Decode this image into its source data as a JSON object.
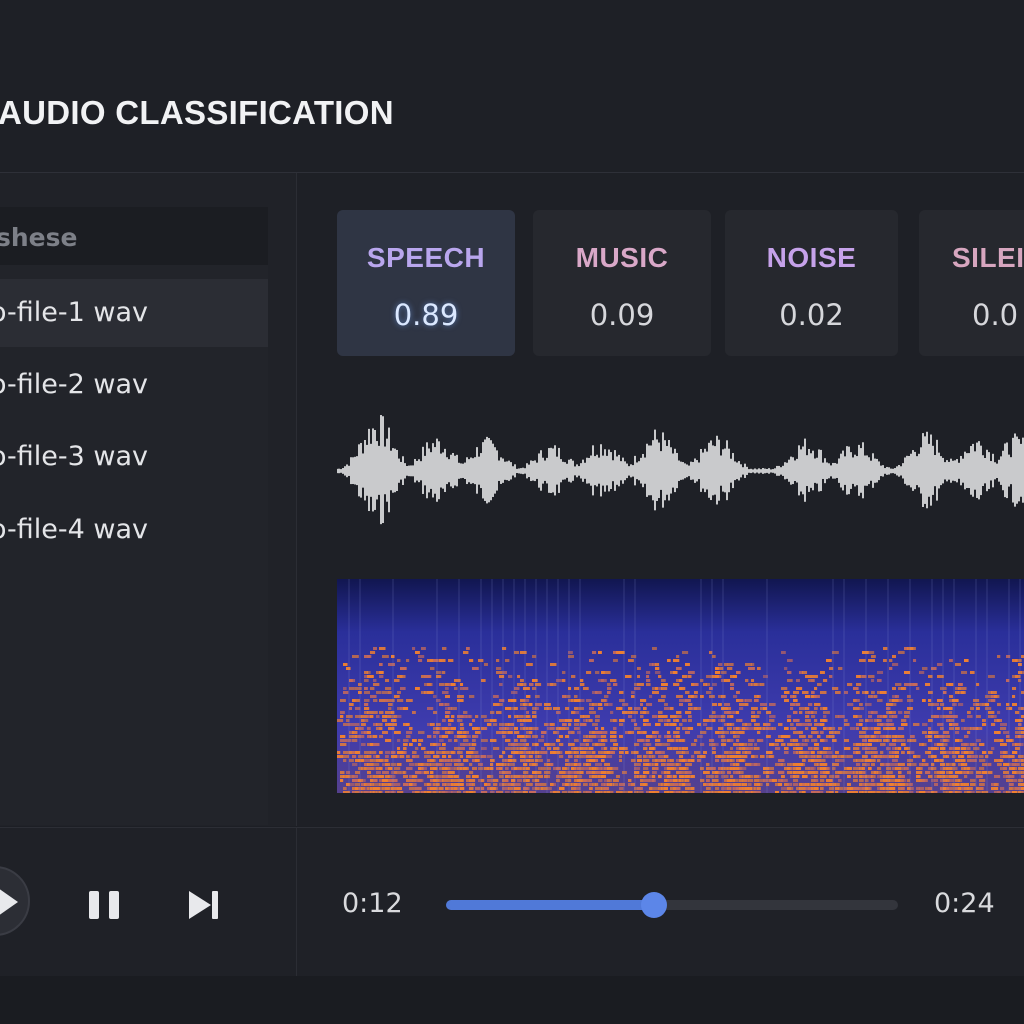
{
  "app": {
    "title": "AUDIO CLASSIFICATION"
  },
  "sidebar": {
    "header": "shese",
    "items": [
      {
        "label": "o-file-1 wav",
        "selected": true
      },
      {
        "label": "o-file-2 wav",
        "selected": false
      },
      {
        "label": "o-file-3 wav",
        "selected": false
      },
      {
        "label": "o-file-4 wav",
        "selected": false
      }
    ]
  },
  "classes": [
    {
      "label": "SPEECH",
      "score": "0.89",
      "color": "#b9a6ee",
      "active": true
    },
    {
      "label": "MUSIC",
      "score": "0.09",
      "color": "#d9a8c8",
      "active": false
    },
    {
      "label": "NOISE",
      "score": "0.02",
      "color": "#c6a2ea",
      "active": false
    },
    {
      "label": "SILEI",
      "score": "0.0",
      "color": "#d7a6bf",
      "active": false
    }
  ],
  "player": {
    "current_time": "0:12",
    "total_time": "0:24",
    "progress": 0.46
  },
  "icons": {
    "play": "play-icon",
    "pause": "pause-icon",
    "next": "skip-next-icon"
  },
  "colors": {
    "accent": "#5079d8",
    "waveform": "#c9cacc",
    "spectrogram_low": "#1e2478",
    "spectrogram_high": "#f08030"
  }
}
